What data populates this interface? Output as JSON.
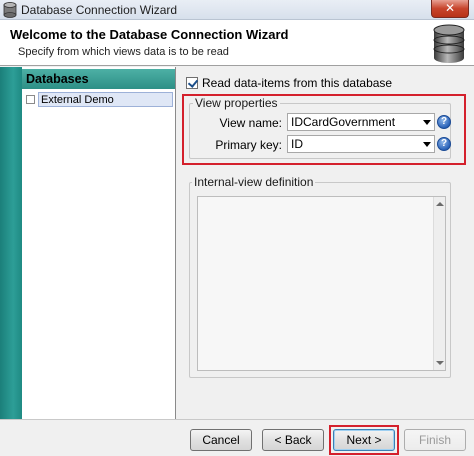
{
  "window": {
    "title": "Database Connection Wizard",
    "close_symbol": "✕"
  },
  "header": {
    "title": "Welcome to the Database Connection Wizard",
    "subtitle": "Specify from which views data is to be read",
    "icon": "database-icon"
  },
  "sidebar": {
    "heading": "Databases",
    "items": [
      {
        "label": "External Demo",
        "checked": false,
        "selected": true
      }
    ]
  },
  "main": {
    "read_checkbox": {
      "label": "Read data-items from this database",
      "checked": true
    },
    "view_properties": {
      "title": "View properties",
      "view_name": {
        "label": "View name:",
        "value": "IDCardGovernment"
      },
      "primary_key": {
        "label": "Primary key:",
        "value": "ID"
      },
      "help_symbol": "?"
    },
    "internal_view": {
      "title": "Internal-view definition",
      "value": ""
    }
  },
  "footer": {
    "cancel": "Cancel",
    "back": "< Back",
    "next": "Next >",
    "finish": "Finish"
  },
  "colors": {
    "accent_teal": "#2d9e97",
    "highlight_red": "#d4202c",
    "help_blue": "#2a62b8"
  }
}
